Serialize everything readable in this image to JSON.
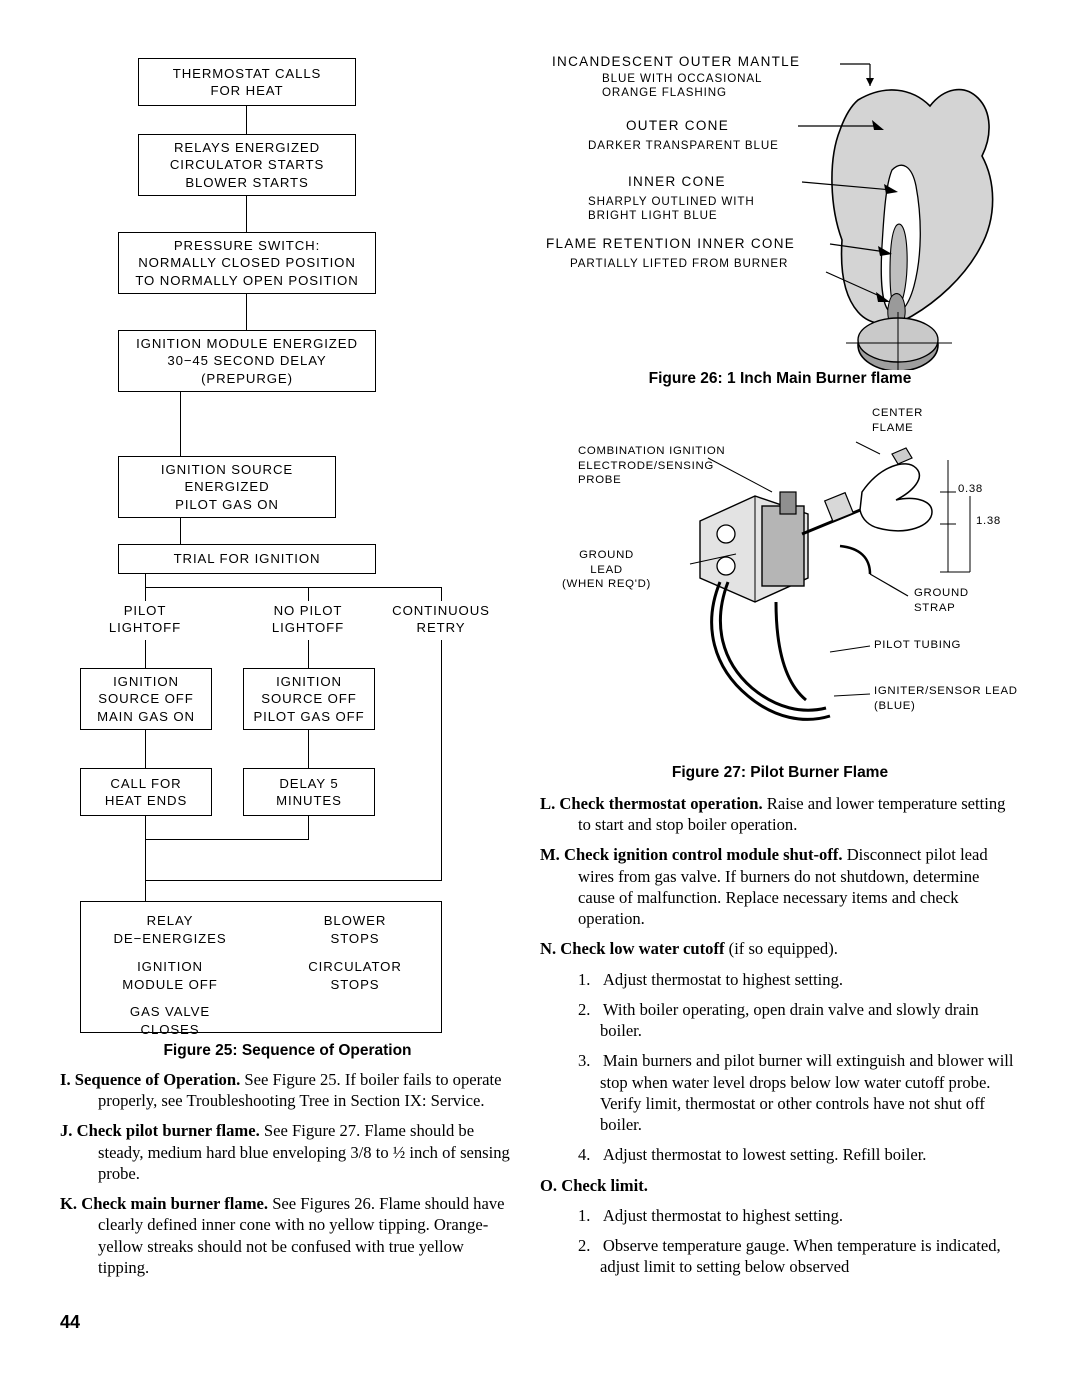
{
  "page": {
    "number": "44"
  },
  "flowchart": {
    "caption": "Figure 25:  Sequence of Operation",
    "boxes": [
      {
        "id": "b1",
        "text": "THERMOSTAT  CALLS\nFOR  HEAT"
      },
      {
        "id": "b2",
        "text": "RELAYS  ENERGIZED\nCIRCULATOR  STARTS\nBLOWER  STARTS"
      },
      {
        "id": "b3",
        "text": "PRESSURE  SWITCH:\nNORMALLY  CLOSED  POSITION\nTO  NORMALLY  OPEN  POSITION"
      },
      {
        "id": "b4",
        "text": "IGNITION  MODULE  ENERGIZED\n30−45  SECOND  DELAY\n(PREPURGE)"
      },
      {
        "id": "b5",
        "text": "IGNITION  SOURCE\nENERGIZED\nPILOT  GAS  ON"
      },
      {
        "id": "b6",
        "text": "TRIAL  FOR  IGNITION"
      },
      {
        "id": "b7",
        "text": "IGNITION\nSOURCE  OFF\nMAIN  GAS  ON"
      },
      {
        "id": "b8",
        "text": "IGNITION\nSOURCE  OFF\nPILOT  GAS  OFF"
      },
      {
        "id": "b9",
        "text": "CALL  FOR\nHEAT  ENDS"
      },
      {
        "id": "b10",
        "text": "DELAY  5\nMINUTES"
      }
    ],
    "branch_labels": [
      {
        "id": "p1",
        "text": "PILOT\nLIGHTOFF"
      },
      {
        "id": "p2",
        "text": "NO  PILOT\nLIGHTOFF"
      },
      {
        "id": "p3",
        "text": "CONTINUOUS\nRETRY"
      }
    ],
    "final_box": [
      {
        "id": "f1",
        "text": "RELAY\nDE−ENERGIZES"
      },
      {
        "id": "f2",
        "text": "BLOWER\nSTOPS"
      },
      {
        "id": "f3",
        "text": "IGNITION\nMODULE  OFF"
      },
      {
        "id": "f4",
        "text": "CIRCULATOR\nSTOPS"
      },
      {
        "id": "f5",
        "text": "GAS  VALVE\nCLOSES"
      }
    ]
  },
  "figure26": {
    "caption": "Figure 26:  1 Inch Main Burner flame",
    "labels": [
      {
        "id": "l1",
        "title": "INCANDESCENT  OUTER  MANTLE",
        "sub": "BLUE  WITH  OCCASIONAL\nORANGE  FLASHING"
      },
      {
        "id": "l2",
        "title": "OUTER  CONE",
        "sub": "DARKER  TRANSPARENT  BLUE"
      },
      {
        "id": "l3",
        "title": "INNER  CONE",
        "sub": "SHARPLY  OUTLINED  WITH\nBRIGHT  LIGHT  BLUE"
      },
      {
        "id": "l4",
        "title": "FLAME  RETENTION  INNER  CONE",
        "sub": "PARTIALLY  LIFTED  FROM  BURNER"
      }
    ]
  },
  "figure27": {
    "caption": "Figure 27:  Pilot Burner Flame",
    "labels": [
      {
        "id": "m1",
        "text": "CENTER\nFLAME"
      },
      {
        "id": "m2",
        "text": "COMBINATION  IGNITION\nELECTRODE/SENSING\nPROBE"
      },
      {
        "id": "m3",
        "text": "GROUND\nLEAD\n(WHEN  REQ'D)"
      },
      {
        "id": "m4",
        "text": "0.38"
      },
      {
        "id": "m5",
        "text": "1.38"
      },
      {
        "id": "m6",
        "text": "GROUND\nSTRAP"
      },
      {
        "id": "m7",
        "text": "PILOT  TUBING"
      },
      {
        "id": "m8",
        "text": "IGNITER/SENSOR  LEAD\n(BLUE)"
      }
    ]
  },
  "left_text": {
    "item_I": {
      "label": "I.",
      "bold": "Sequence of Operation.",
      "body": " See Figure 25. If boiler fails to operate properly, see Troubleshooting Tree in Section IX:  Service."
    },
    "item_J": {
      "label": "J.",
      "bold": "Check pilot burner flame.",
      "body": " See Figure 27.  Flame should be steady, medium hard blue enveloping 3/8 to ½ inch of sensing probe."
    },
    "item_K": {
      "label": "K.",
      "bold": "Check main burner flame.",
      "body": " See Figures 26.  Flame should have clearly defined inner cone with no yellow tipping. Orange-yellow streaks should not be confused with true yellow tipping."
    }
  },
  "right_text": {
    "item_L": {
      "label": "L.",
      "bold": "Check thermostat operation.",
      "body": " Raise and lower temperature setting to start and stop boiler operation."
    },
    "item_M": {
      "label": "M.",
      "bold": "Check ignition control module shut-off.",
      "body": " Disconnect pilot lead wires from gas valve.  If burners do not shutdown, determine cause of malfunction.  Replace necessary items and check operation."
    },
    "item_N": {
      "label": "N.",
      "bold": "Check low water cutoff",
      "body": " (if so equipped).",
      "steps": [
        {
          "num": "1.",
          "text": "Adjust thermostat to highest setting."
        },
        {
          "num": "2.",
          "text": "With boiler operating, open drain valve and slowly drain boiler."
        },
        {
          "num": "3.",
          "text": "Main burners and pilot burner will extinguish and blower will stop when water level drops below low water cutoff probe. Verify limit, thermostat or other controls have not shut off boiler."
        },
        {
          "num": "4.",
          "text": "Adjust thermostat to lowest setting. Refill boiler."
        }
      ]
    },
    "item_O": {
      "label": "O.",
      "bold": "Check limit.",
      "body": "",
      "steps": [
        {
          "num": "1.",
          "text": "Adjust thermostat to highest setting."
        },
        {
          "num": "2.",
          "text": "Observe temperature gauge. When temperature is indicated, adjust limit to setting below observed"
        }
      ]
    }
  }
}
